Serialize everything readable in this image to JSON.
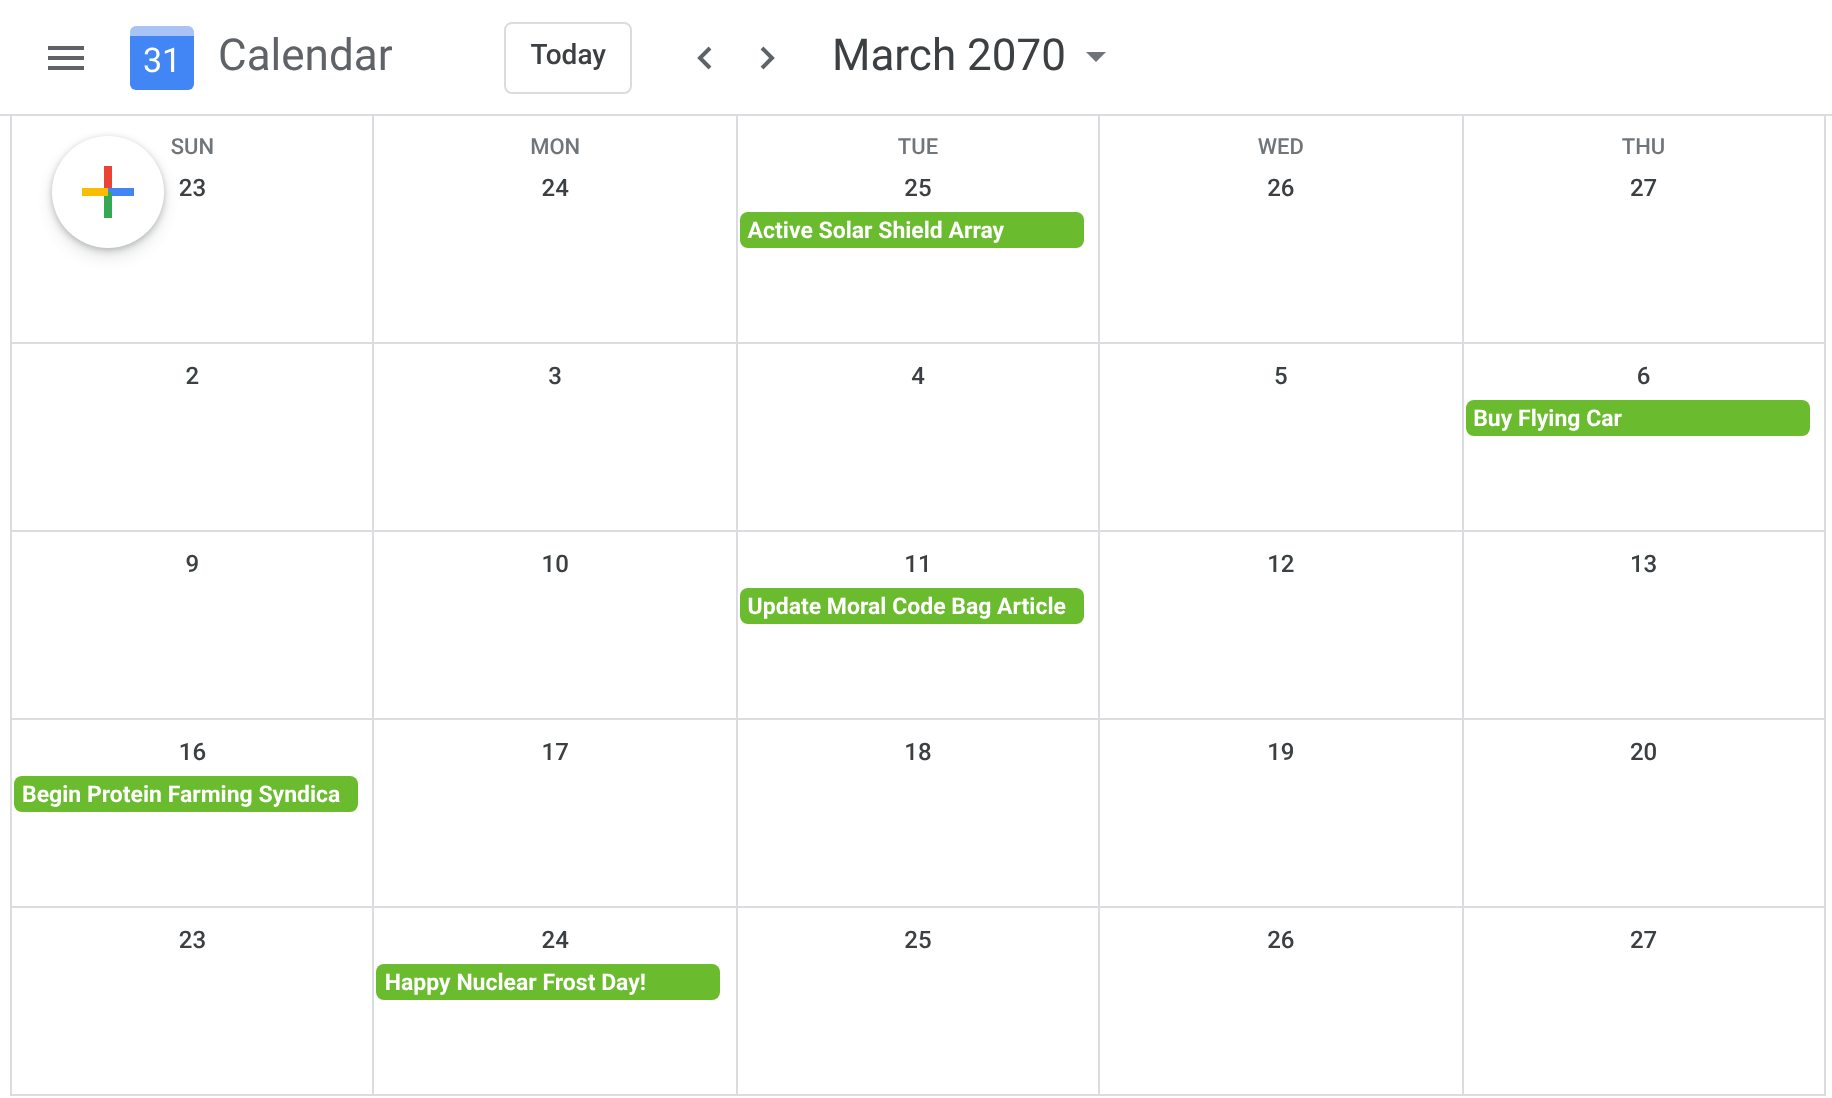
{
  "header": {
    "app_name": "Calendar",
    "logo_day": "31",
    "today_button": "Today",
    "month_title": "March 2070"
  },
  "weekdays": [
    "SUN",
    "MON",
    "TUE",
    "WED",
    "THU"
  ],
  "weeks": [
    {
      "days": [
        {
          "date": "23"
        },
        {
          "date": "24"
        },
        {
          "date": "25",
          "events": [
            {
              "title": "Active Solar Shield Array",
              "color": "#6bbb2e"
            }
          ]
        },
        {
          "date": "26"
        },
        {
          "date": "27"
        }
      ]
    },
    {
      "days": [
        {
          "date": "2"
        },
        {
          "date": "3"
        },
        {
          "date": "4"
        },
        {
          "date": "5"
        },
        {
          "date": "6",
          "events": [
            {
              "title": "Buy Flying Car",
              "color": "#6bbb2e"
            }
          ]
        }
      ]
    },
    {
      "days": [
        {
          "date": "9"
        },
        {
          "date": "10"
        },
        {
          "date": "11",
          "events": [
            {
              "title": "Update Moral Code Bag Article",
              "color": "#6bbb2e"
            }
          ]
        },
        {
          "date": "12"
        },
        {
          "date": "13"
        }
      ]
    },
    {
      "days": [
        {
          "date": "16",
          "events": [
            {
              "title": "Begin Protein Farming Syndica",
              "color": "#6bbb2e"
            }
          ]
        },
        {
          "date": "17"
        },
        {
          "date": "18"
        },
        {
          "date": "19"
        },
        {
          "date": "20"
        }
      ]
    },
    {
      "days": [
        {
          "date": "23"
        },
        {
          "date": "24",
          "events": [
            {
              "title": "Happy Nuclear Frost Day!",
              "color": "#6bbb2e"
            }
          ]
        },
        {
          "date": "25"
        },
        {
          "date": "26"
        },
        {
          "date": "27"
        }
      ]
    }
  ]
}
